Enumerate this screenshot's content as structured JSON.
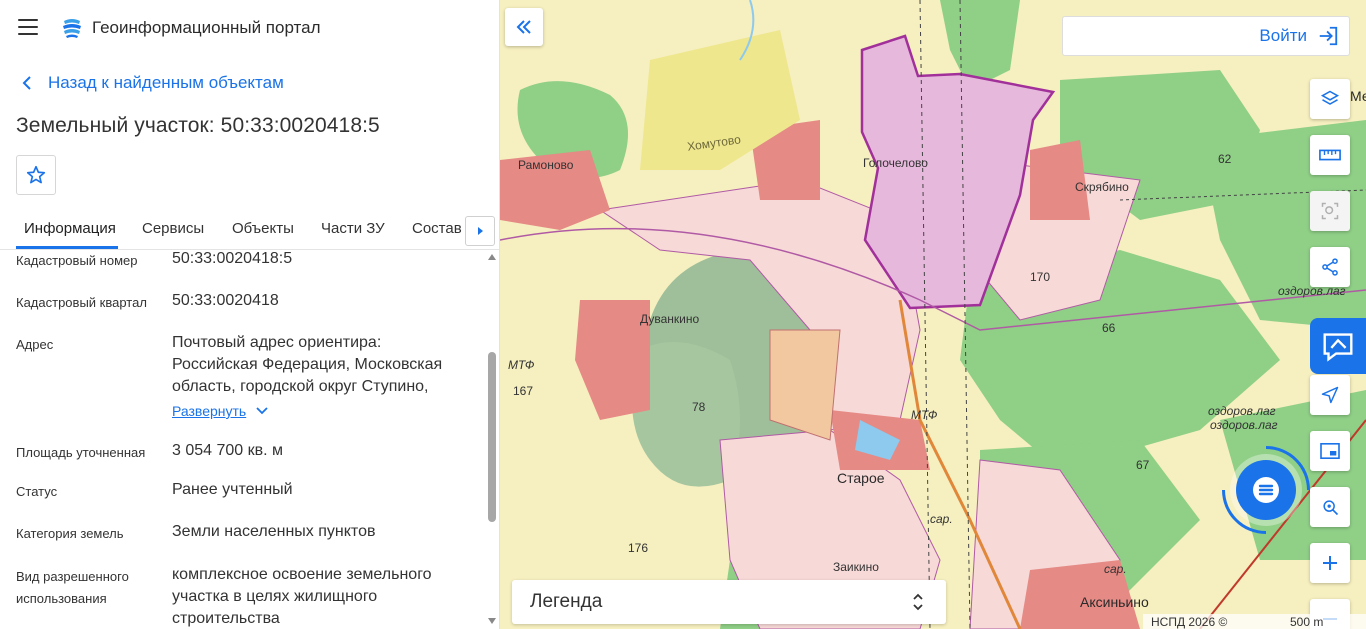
{
  "header": {
    "app_title": "Геоинформационный портал",
    "menu_icon": "hamburger-menu-icon",
    "logo_icon": "portal-logo-icon"
  },
  "back_link": {
    "label": "Назад к найденным объектам"
  },
  "object": {
    "title": "Земельный участок: 50:33:0020418:5"
  },
  "tabs": [
    {
      "label": "Информация",
      "active": true
    },
    {
      "label": "Сервисы"
    },
    {
      "label": "Объекты"
    },
    {
      "label": "Части ЗУ"
    },
    {
      "label": "Состав"
    }
  ],
  "info_rows": {
    "cadastral_number": {
      "label": "Кадастровый номер",
      "value": "50:33:0020418:5"
    },
    "cadastral_quarter": {
      "label": "Кадастровый квартал",
      "value": "50:33:0020418"
    },
    "address": {
      "label": "Адрес",
      "line1": "Почтовый адрес ориентира:",
      "line2": "Российская Федерация, Московская",
      "line3": "область, городской округ Ступино,",
      "expand": "Развернуть"
    },
    "area": {
      "label": "Площадь уточненная",
      "value": "3 054 700 кв. м"
    },
    "status": {
      "label": "Статус",
      "value": "Ранее учтенный"
    },
    "category": {
      "label": "Категория земель",
      "value": "Земли населенных пунктов"
    },
    "permitted_use": {
      "label_line1": "Вид разрешенного",
      "label_line2": "использования",
      "line1": "комплексное освоение земельного",
      "line2": "участка в целях жилищного",
      "line3": "строительства"
    }
  },
  "map": {
    "login_label": "Войти",
    "legend_label": "Легенда",
    "attribution": "НСПД 2026 ©",
    "scale": "500 m",
    "places": {
      "golochelovo": "Голочелово",
      "skryabino": "Скрябино",
      "staroe": "Старое",
      "zaykino": "Заикино",
      "aksinino": "Аксиньино",
      "ramonovo": "Рамоново",
      "khomutovo": "Хомутово",
      "duvakino": "Дуванкино",
      "mtf1": "МТФ",
      "mtf2": "МТФ",
      "ozdorov1": "оздоров.лаг",
      "ozdorov2": "оздоров.лаг",
      "ozdorov3": "оздоров.лаг",
      "sar1": "сар.",
      "sar2": "сар.",
      "n62": "62",
      "n66": "66",
      "n67": "67",
      "n78": "78",
      "n167": "167",
      "n170": "170",
      "n176": "176",
      "me": "Ме"
    }
  },
  "colors": {
    "accent": "#1a73e8",
    "parcel_fill": "#e6b8dc",
    "parcel_stroke": "#a1309a"
  }
}
